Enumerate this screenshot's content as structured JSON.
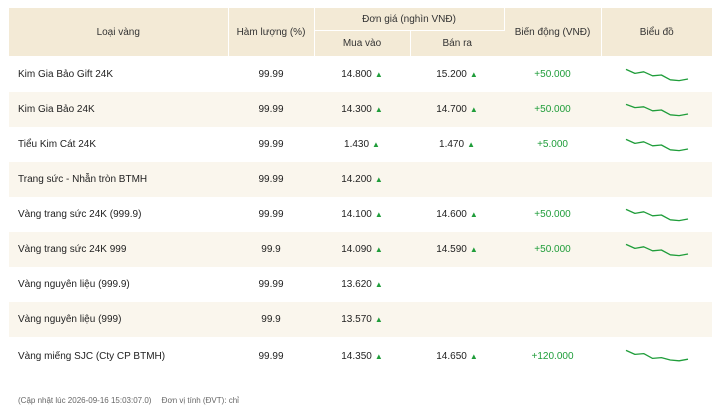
{
  "table": {
    "headers": {
      "type": "Loại vàng",
      "purity": "Hàm lượng (%)",
      "price_group": "Đơn giá (nghìn VNĐ)",
      "buy": "Mua vào",
      "sell": "Bán ra",
      "change": "Biến động (VNĐ)",
      "chart": "Biểu đồ"
    },
    "rows": [
      {
        "name": "Kim Gia Bảo Gift 24K",
        "purity": "99.99",
        "buy": "14.800",
        "sell": "15.200",
        "change": "+50.000",
        "spark": [
          0.85,
          0.6,
          0.7,
          0.45,
          0.5,
          0.2,
          0.15,
          0.25
        ]
      },
      {
        "name": "Kim Gia Bảo 24K",
        "purity": "99.99",
        "buy": "14.300",
        "sell": "14.700",
        "change": "+50.000",
        "spark": [
          0.85,
          0.65,
          0.7,
          0.45,
          0.5,
          0.2,
          0.15,
          0.25
        ]
      },
      {
        "name": "Tiểu Kim Cát 24K",
        "purity": "99.99",
        "buy": "1.430",
        "sell": "1.470",
        "change": "+5.000",
        "spark": [
          0.85,
          0.6,
          0.7,
          0.45,
          0.5,
          0.2,
          0.15,
          0.25
        ]
      },
      {
        "name": "Trang sức - Nhẫn tròn BTMH",
        "purity": "99.99",
        "buy": "14.200",
        "sell": "",
        "change": "",
        "spark": []
      },
      {
        "name": "Vàng trang sức 24K (999.9)",
        "purity": "99.99",
        "buy": "14.100",
        "sell": "14.600",
        "change": "+50.000",
        "spark": [
          0.85,
          0.6,
          0.7,
          0.45,
          0.5,
          0.2,
          0.15,
          0.25
        ]
      },
      {
        "name": "Vàng trang sức 24K 999",
        "purity": "99.9",
        "buy": "14.090",
        "sell": "14.590",
        "change": "+50.000",
        "spark": [
          0.85,
          0.6,
          0.7,
          0.45,
          0.5,
          0.2,
          0.15,
          0.25
        ]
      },
      {
        "name": "Vàng nguyên liệu (999.9)",
        "purity": "99.99",
        "buy": "13.620",
        "sell": "",
        "change": "",
        "spark": []
      },
      {
        "name": "Vàng nguyên liệu (999)",
        "purity": "99.9",
        "buy": "13.570",
        "sell": "",
        "change": "",
        "spark": []
      },
      {
        "name": "Vàng miếng SJC (Cty CP BTMH)",
        "purity": "99.99",
        "buy": "14.350",
        "sell": "14.650",
        "change": "+120.000",
        "spark": [
          0.85,
          0.6,
          0.65,
          0.35,
          0.4,
          0.25,
          0.2,
          0.3
        ]
      }
    ],
    "arrow_glyph": "▲"
  },
  "footer": {
    "updated": "(Cập nhật lúc 2026-09-16 15:03:07.0)",
    "unit": "Đơn vị tính (ĐVT): chỉ"
  },
  "colors": {
    "header_bg": "#f3ead6",
    "alt_row_bg": "#faf6ed",
    "up_green": "#1f9d3a"
  }
}
